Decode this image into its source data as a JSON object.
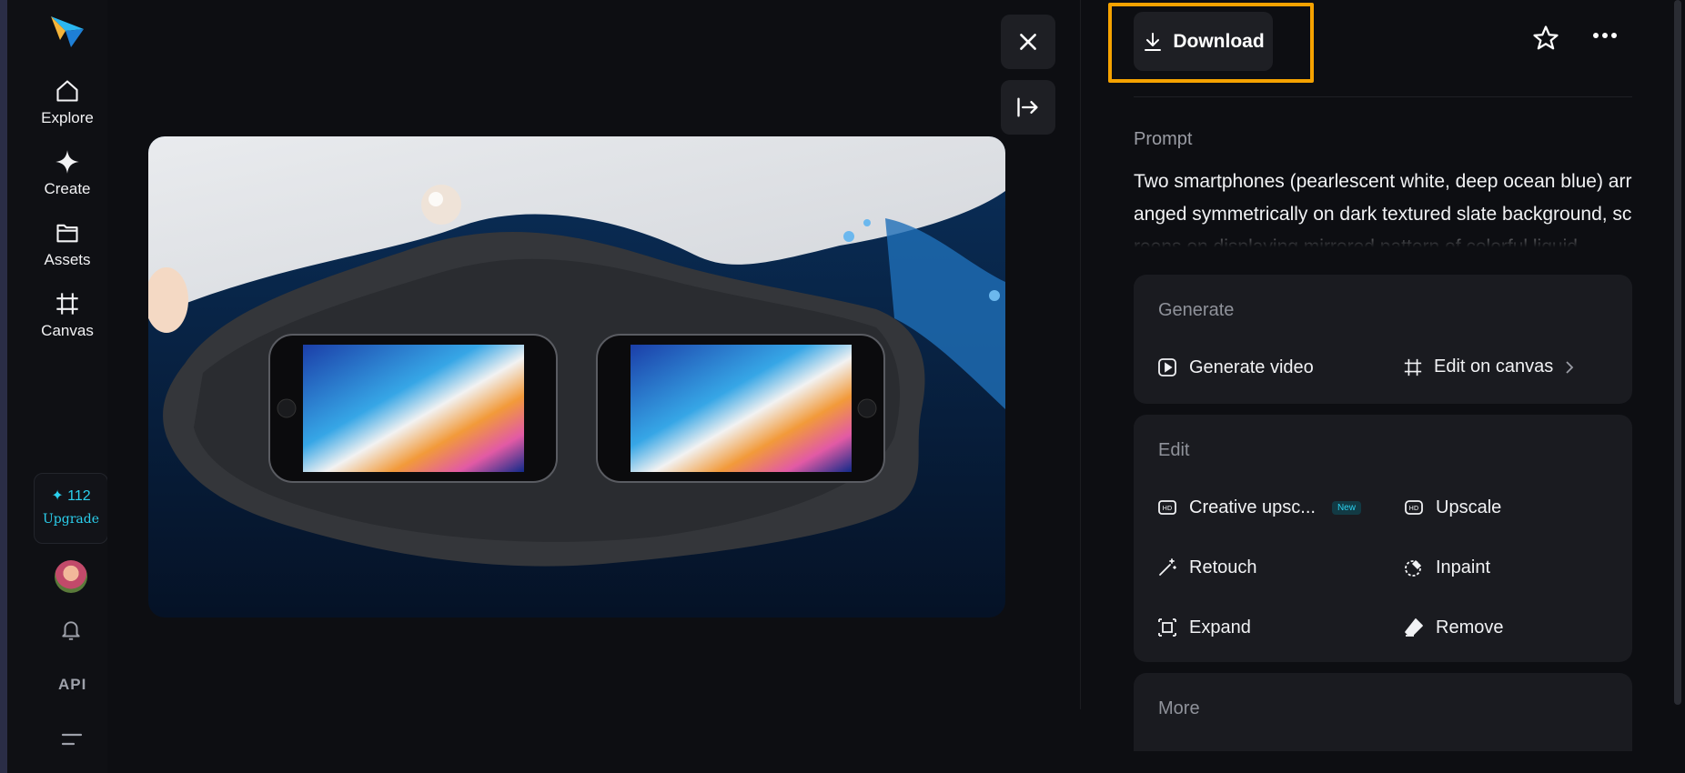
{
  "sidebar": {
    "items": [
      {
        "label": "Explore",
        "icon": "home-icon"
      },
      {
        "label": "Create",
        "icon": "sparkle-icon"
      },
      {
        "label": "Assets",
        "icon": "folder-icon"
      },
      {
        "label": "Canvas",
        "icon": "canvas-icon"
      }
    ],
    "credits": {
      "count": "✦ 112",
      "upgrade_label": "Upgrade"
    },
    "api_label": "API"
  },
  "panel": {
    "download_label": "Download",
    "prompt_label": "Prompt",
    "prompt_text": "Two smartphones (pearlescent white, deep ocean blue) arranged symmetrically on dark textured slate background, screens on displaying mirrored pattern of colorful liquid",
    "generate": {
      "title": "Generate",
      "actions": [
        {
          "label": "Generate video",
          "icon": "play-square-icon"
        },
        {
          "label": "Edit on canvas",
          "icon": "canvas-icon"
        }
      ]
    },
    "edit": {
      "title": "Edit",
      "actions": [
        {
          "label": "Creative upsc...",
          "icon": "hdr-icon",
          "badge": "New"
        },
        {
          "label": "Upscale",
          "icon": "hd-icon"
        },
        {
          "label": "Retouch",
          "icon": "magic-wand-icon"
        },
        {
          "label": "Inpaint",
          "icon": "inpaint-icon"
        },
        {
          "label": "Expand",
          "icon": "expand-icon"
        },
        {
          "label": "Remove",
          "icon": "eraser-icon"
        }
      ]
    },
    "more": {
      "title": "More"
    }
  },
  "colors": {
    "accent": "#2bd0ee",
    "highlight": "#f5a200",
    "background": "#0d0e12",
    "card": "#1a1b20"
  }
}
